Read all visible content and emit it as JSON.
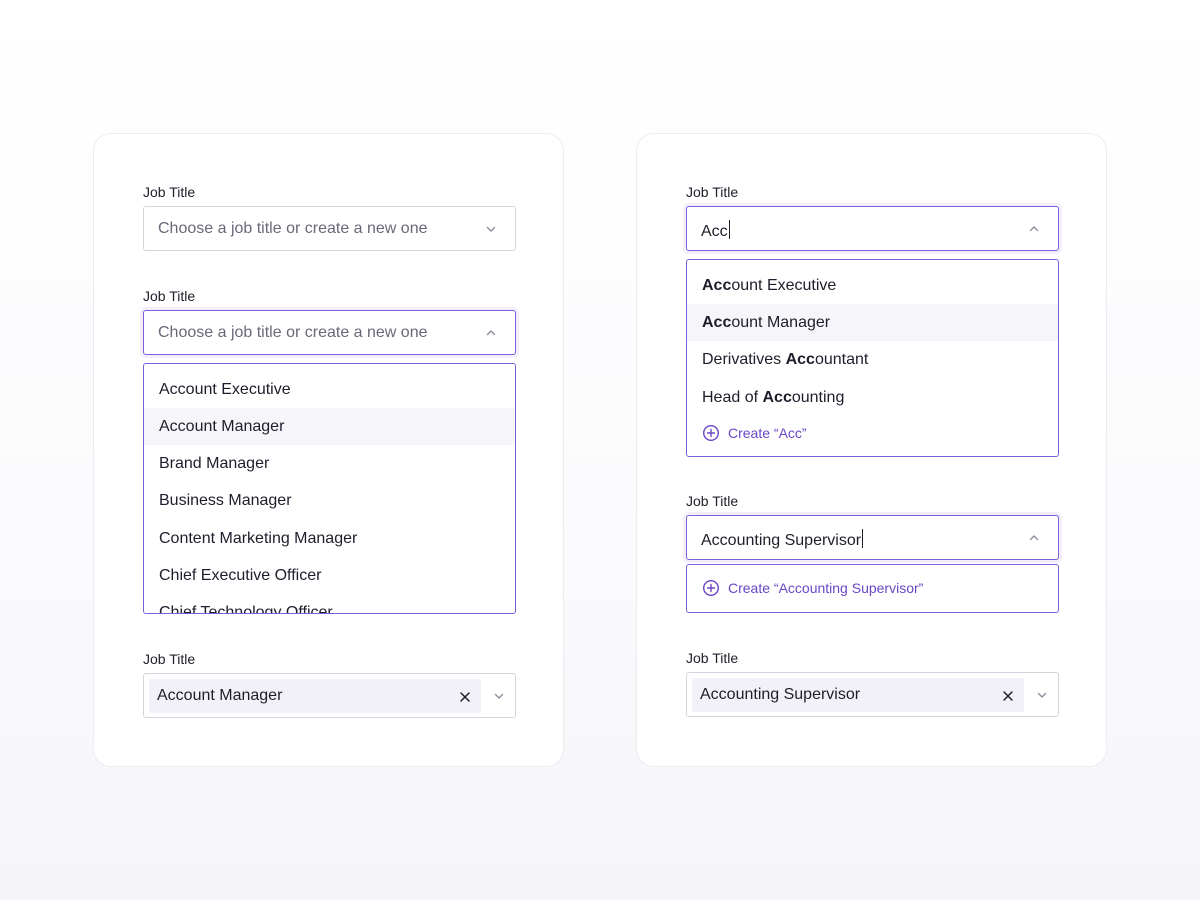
{
  "left_card": {
    "field1": {
      "label": "Job Title",
      "placeholder": "Choose a job title or create a new one"
    },
    "field2": {
      "label": "Job Title",
      "placeholder": "Choose a job title or create a new one",
      "options": [
        "Account Executive",
        "Account Manager",
        "Brand Manager",
        "Business Manager",
        "Content Marketing Manager",
        "Chief Executive Officer",
        "Chief Technology Officer"
      ],
      "highlighted_option": "Account Manager"
    },
    "field3": {
      "label": "Job Title",
      "selected": "Account Manager"
    }
  },
  "right_card": {
    "field1": {
      "label": "Job Title",
      "value": "Acc",
      "options": [
        {
          "match": "Acc",
          "rest": "ount Executive",
          "prefix": ""
        },
        {
          "match": "Acc",
          "rest": "ount Manager",
          "prefix": ""
        },
        {
          "prefix": "Derivatives ",
          "match": "Acc",
          "rest": "ountant"
        },
        {
          "prefix": "Head of ",
          "match": "Acc",
          "rest": "ounting"
        }
      ],
      "highlighted_option": "Account Manager",
      "create_label": "Create “Acc”"
    },
    "field2": {
      "label": "Job Title",
      "value": "Accounting Supervisor",
      "create_label": "Create “Accounting Supervisor”"
    },
    "field3": {
      "label": "Job Title",
      "selected": "Accounting Supervisor"
    }
  },
  "colors": {
    "accent": "#7c5fd8",
    "accent_text": "#6b46c6",
    "border": "#d4d3de",
    "chip_bg": "#f2f1f7",
    "hover_bg": "#f6f5fa"
  },
  "icons": {
    "chevron_down": "chevron-down-icon",
    "chevron_up": "chevron-up-icon",
    "clear": "close-icon",
    "create": "plus-circle-icon"
  }
}
